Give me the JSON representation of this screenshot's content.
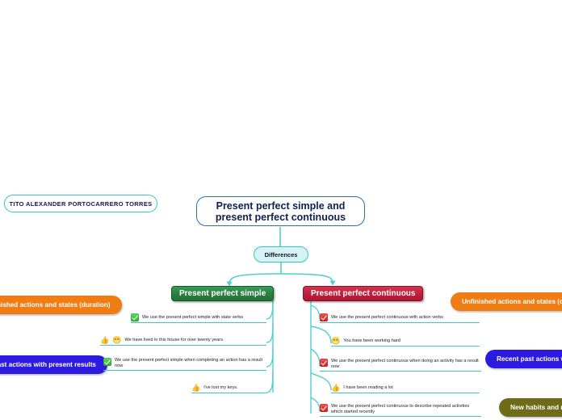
{
  "author": {
    "name": "TITO ALEXANDER PORTOCARRERO TORRES"
  },
  "root": {
    "title": "Present perfect simple and present perfect continuous"
  },
  "hub": {
    "label": "Differences"
  },
  "branches": [
    {
      "id": "present-perfect-simple",
      "header": "Present perfect simple",
      "color": "#2e8145",
      "categories": [
        {
          "label": "Unfinished actions and states (duration)",
          "color": "#f07d13"
        },
        {
          "label": "Recent past actions with present results",
          "color": "#2d1ae0"
        }
      ],
      "leaves": [
        {
          "icon": "green-check-icon",
          "text": "We use the present perfect simple with state verbs"
        },
        {
          "icon": "thumbs-up-icon",
          "icon2": "grinning-face-icon",
          "text": "We have lived in this house for over twenty years."
        },
        {
          "icon": "green-check-icon",
          "text": "We use the present perfect simple when completing an action has a result now"
        },
        {
          "icon": "thumbs-up-icon",
          "text": "I've lost my keys."
        }
      ]
    },
    {
      "id": "present-perfect-continuous",
      "header": "Present perfect continuous",
      "color": "#bf2340",
      "categories": [
        {
          "label": "Unfinished actions and states (duration)",
          "color": "#f07d13"
        },
        {
          "label": "Recent past actions with present results",
          "color": "#2d1ae0"
        },
        {
          "label": "New habits and repeated activities",
          "color": "#6e6c19"
        }
      ],
      "leaves": [
        {
          "icon": "red-check-icon",
          "text": "We use the present perfect continuous with action verbs"
        },
        {
          "icon": "grinning-face-icon",
          "text": "You have been working hard"
        },
        {
          "icon": "red-check-icon",
          "text": "We use the present perfect continuous when doing an activity has a result now"
        },
        {
          "icon": "thumbs-up-icon",
          "text": "I have been reading a lot"
        },
        {
          "icon": "red-check-icon",
          "text": "We use the present perfect continuous to describe repeated activities which started recently"
        }
      ]
    }
  ],
  "icons": {
    "thumbs-up-icon": "👍",
    "grinning-face-icon": "😁"
  },
  "theme": {
    "connector": "#4fd0cc",
    "root_border": "#2b6fb5",
    "pill_border": "#36c6c0",
    "hub_fill": "#d6f2f4"
  }
}
